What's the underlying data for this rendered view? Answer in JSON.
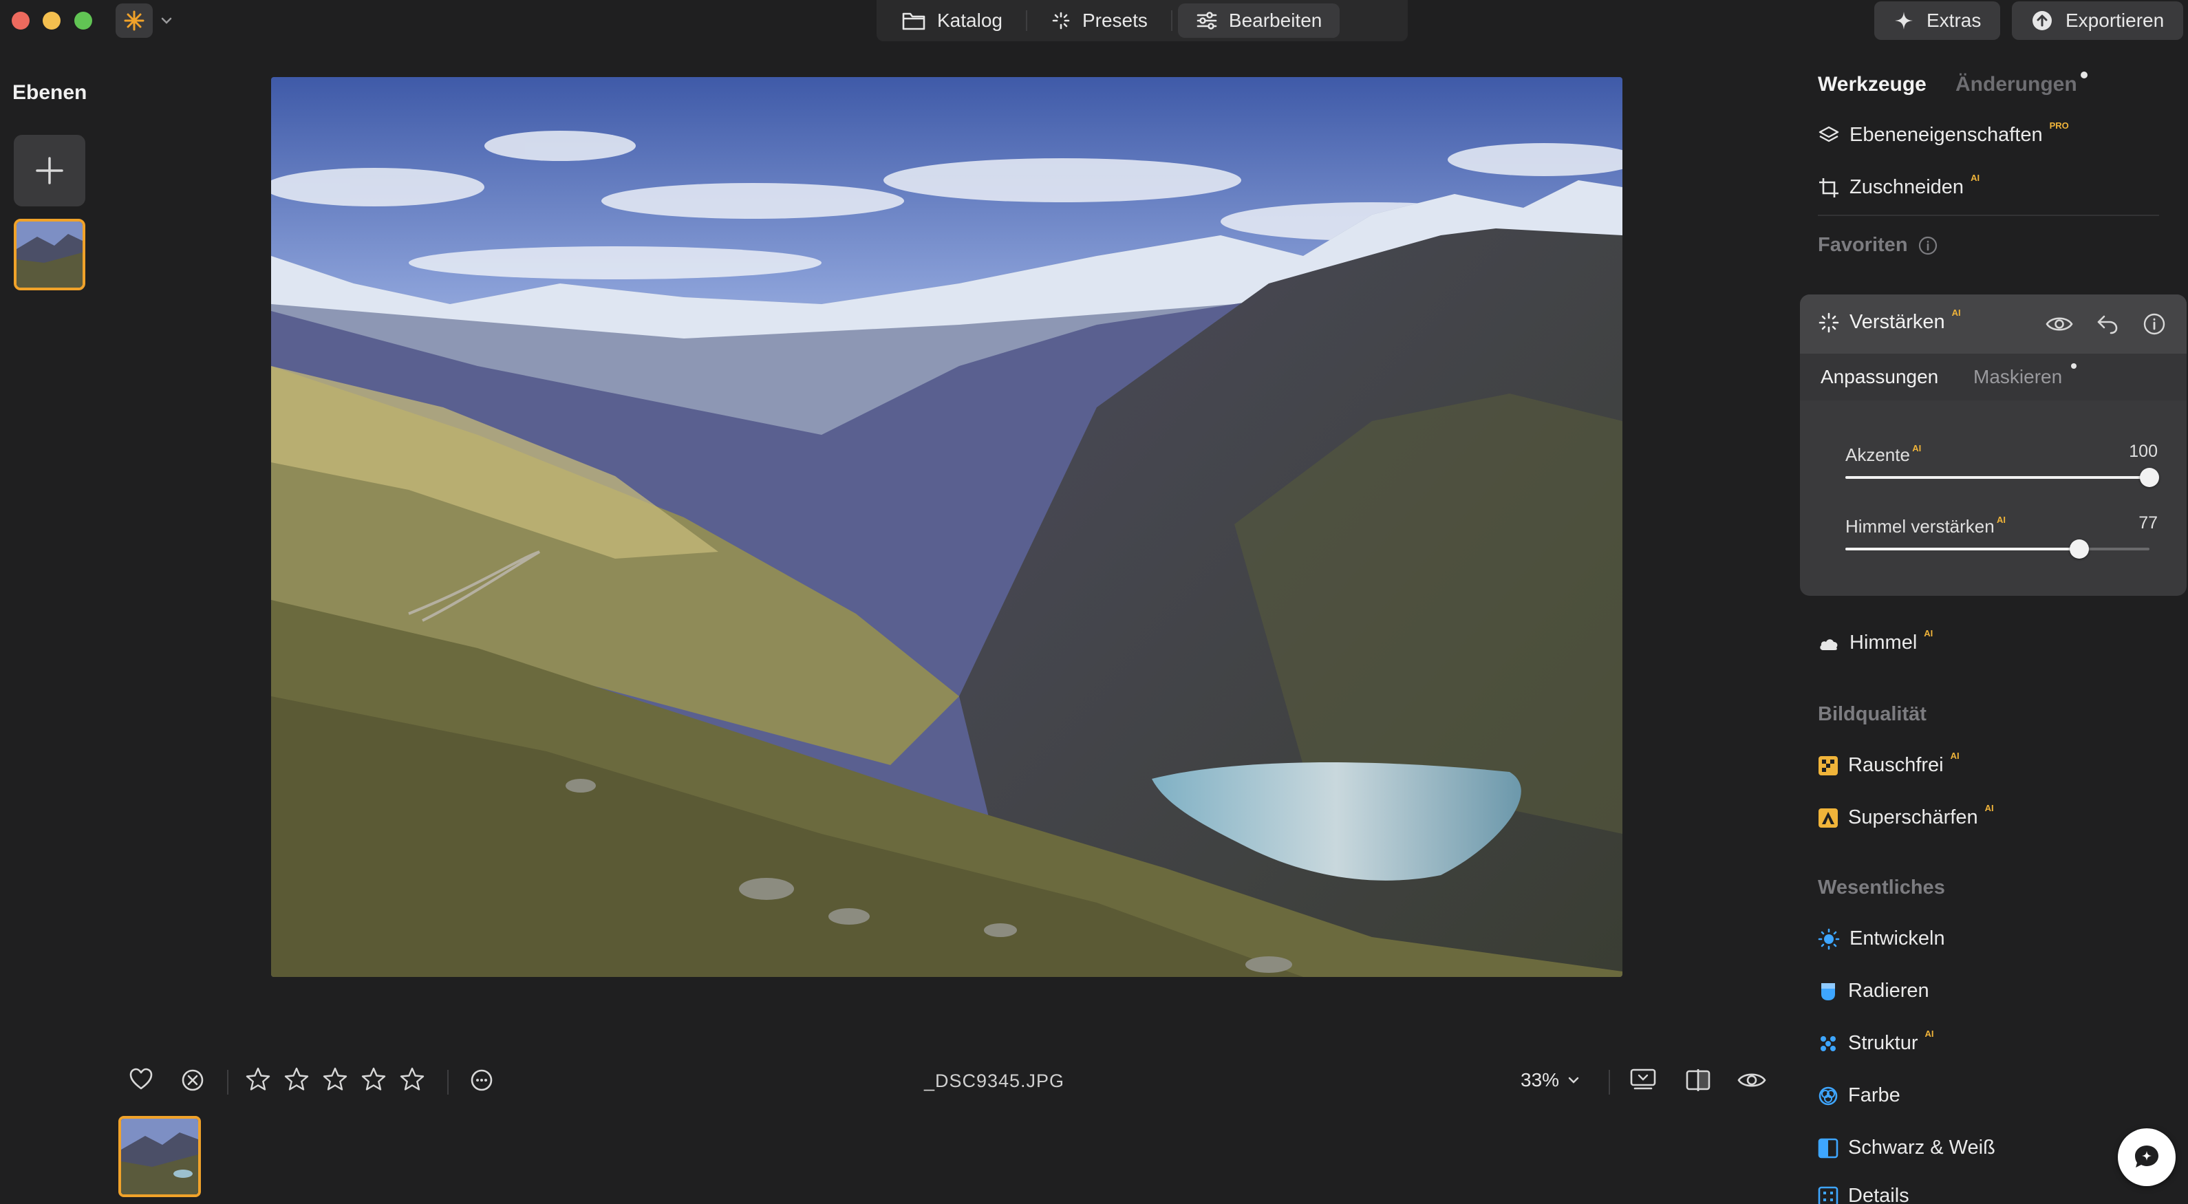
{
  "window": {
    "traffic_lights": [
      "close",
      "minimize",
      "zoom"
    ],
    "app_icon": "sun-burst-icon"
  },
  "topnav": {
    "items": [
      {
        "label": "Katalog",
        "icon": "folder-icon"
      },
      {
        "label": "Presets",
        "icon": "sparkle-icon"
      },
      {
        "label": "Bearbeiten",
        "icon": "sliders-icon",
        "active": true
      }
    ]
  },
  "topright": {
    "extras_label": "Extras",
    "export_label": "Exportieren"
  },
  "layers": {
    "title": "Ebenen"
  },
  "bottombar": {
    "filename": "_DSC9345.JPG",
    "zoom": "33%",
    "rating_stars": 5,
    "rating_value": 0
  },
  "rightpanel": {
    "tab_tools": "Werkzeuge",
    "tab_changes": "Änderungen",
    "layer_props": "Ebeneneigenschaften",
    "crop": "Zuschneiden",
    "favorites": "Favoriten",
    "enhance": {
      "title": "Verstärken",
      "subtab_adjust": "Anpassungen",
      "subtab_mask": "Maskieren",
      "sliders": [
        {
          "label": "Akzente",
          "value": "100",
          "fraction": 1.0
        },
        {
          "label": "Himmel verstärken",
          "value": "77",
          "fraction": 0.77
        }
      ]
    },
    "sky": "Himmel",
    "section_quality": "Bildqualität",
    "noise": "Rauschfrei",
    "sharpen": "Superschärfen",
    "section_essentials": "Wesentliches",
    "develop": "Entwickeln",
    "erase": "Radieren",
    "structure": "Struktur",
    "color": "Farbe",
    "bw": "Schwarz & Weiß",
    "details": "Details",
    "ai_badge": "AI",
    "pro_badge": "PRO"
  },
  "colors": {
    "accent": "#f0a22a",
    "background": "#1f1f20",
    "panel": "#3a3a3c"
  }
}
